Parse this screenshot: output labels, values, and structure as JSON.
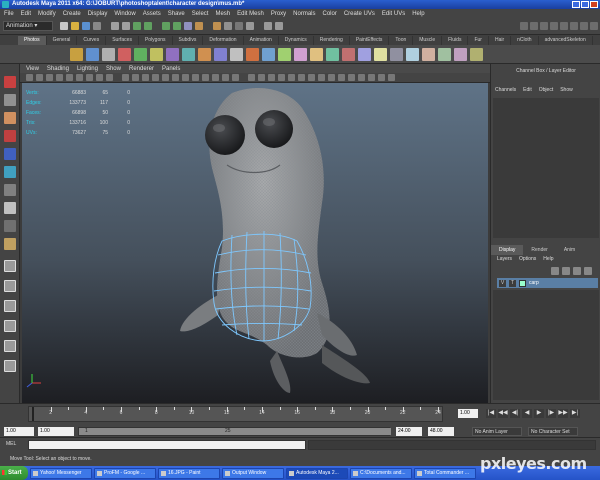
{
  "window": {
    "title": "Autodesk Maya 2011 x64: G:\\JOBURT\\photoshoptalent\\character design\\mus.mb*"
  },
  "menubar": {
    "items": [
      "File",
      "Edit",
      "Modify",
      "Create",
      "Display",
      "Window",
      "Assets",
      "Shave",
      "Select",
      "Mesh",
      "Edit Mesh",
      "Proxy",
      "Normals",
      "Color",
      "Create UVs",
      "Edit UVs",
      "Help"
    ]
  },
  "status_line": {
    "mode": "Animation"
  },
  "shelf": {
    "tabs": [
      "Photos",
      "General",
      "Curves",
      "Surfaces",
      "Polygons",
      "Subdivs",
      "Deformation",
      "Animation",
      "Dynamics",
      "Rendering",
      "PaintEffects",
      "Toon",
      "Muscle",
      "Fluids",
      "Fur",
      "Hair",
      "nCloth",
      "advancedSkeleton"
    ],
    "active_tab": "Photos"
  },
  "panel": {
    "menu": [
      "View",
      "Shading",
      "Lighting",
      "Show",
      "Renderer",
      "Panels"
    ]
  },
  "hud": {
    "rows": [
      {
        "label": "Verts:",
        "v1": "66883",
        "v2": "65",
        "v3": "0"
      },
      {
        "label": "Edges:",
        "v1": "133773",
        "v2": "117",
        "v3": "0"
      },
      {
        "label": "Faces:",
        "v1": "66898",
        "v2": "50",
        "v3": "0"
      },
      {
        "label": "Tris:",
        "v1": "133716",
        "v2": "100",
        "v3": "0"
      },
      {
        "label": "UVs:",
        "v1": "73627",
        "v2": "75",
        "v3": "0"
      }
    ]
  },
  "channel_box": {
    "title": "Channel Box / Layer Editor",
    "menu": [
      "Channels",
      "Edit",
      "Object",
      "Show"
    ]
  },
  "layer_editor": {
    "tabs": [
      "Display",
      "Render",
      "Anim"
    ],
    "active_tab": "Display",
    "menu": [
      "Layers",
      "Options",
      "Help"
    ],
    "layer": {
      "v": "V",
      "t": "T",
      "name": "carp"
    }
  },
  "time_slider": {
    "ticks": [
      "2",
      "4",
      "6",
      "8",
      "10",
      "12",
      "14",
      "16",
      "18",
      "20",
      "22",
      "24"
    ],
    "current_frame": "1.00",
    "playback": [
      "|◀",
      "◀◀",
      "◀|",
      "◀",
      "▶",
      "|▶",
      "▶▶",
      "▶|"
    ]
  },
  "range_slider": {
    "start": "1.00",
    "playback_start": "1.00",
    "range_start_label": "1",
    "range_end_label": "25",
    "playback_end": "24.00",
    "end": "48.00",
    "anim_layer": "No Anim Layer",
    "character_set": "No Character Set"
  },
  "command_line": {
    "label": "MEL"
  },
  "help_line": {
    "text": "Move Tool: Select an object to move."
  },
  "taskbar": {
    "start": "Start",
    "tasks": [
      {
        "label": "Yahoo! Messenger",
        "active": false
      },
      {
        "label": "ProFM - Google ...",
        "active": false
      },
      {
        "label": "16.JPG - Paint",
        "active": false
      },
      {
        "label": "Output Window",
        "active": false
      },
      {
        "label": "Autodesk Maya 2...",
        "active": true
      },
      {
        "label": "C:\\Documents and...",
        "active": false
      },
      {
        "label": "Total Commander ...",
        "active": false
      }
    ]
  },
  "watermark": {
    "text": "pxleyes.com"
  },
  "colors": {
    "selection_wire": "#7ec8ff",
    "hud_label": "#2fd0e8",
    "layer_row": "#5a7fa5"
  }
}
